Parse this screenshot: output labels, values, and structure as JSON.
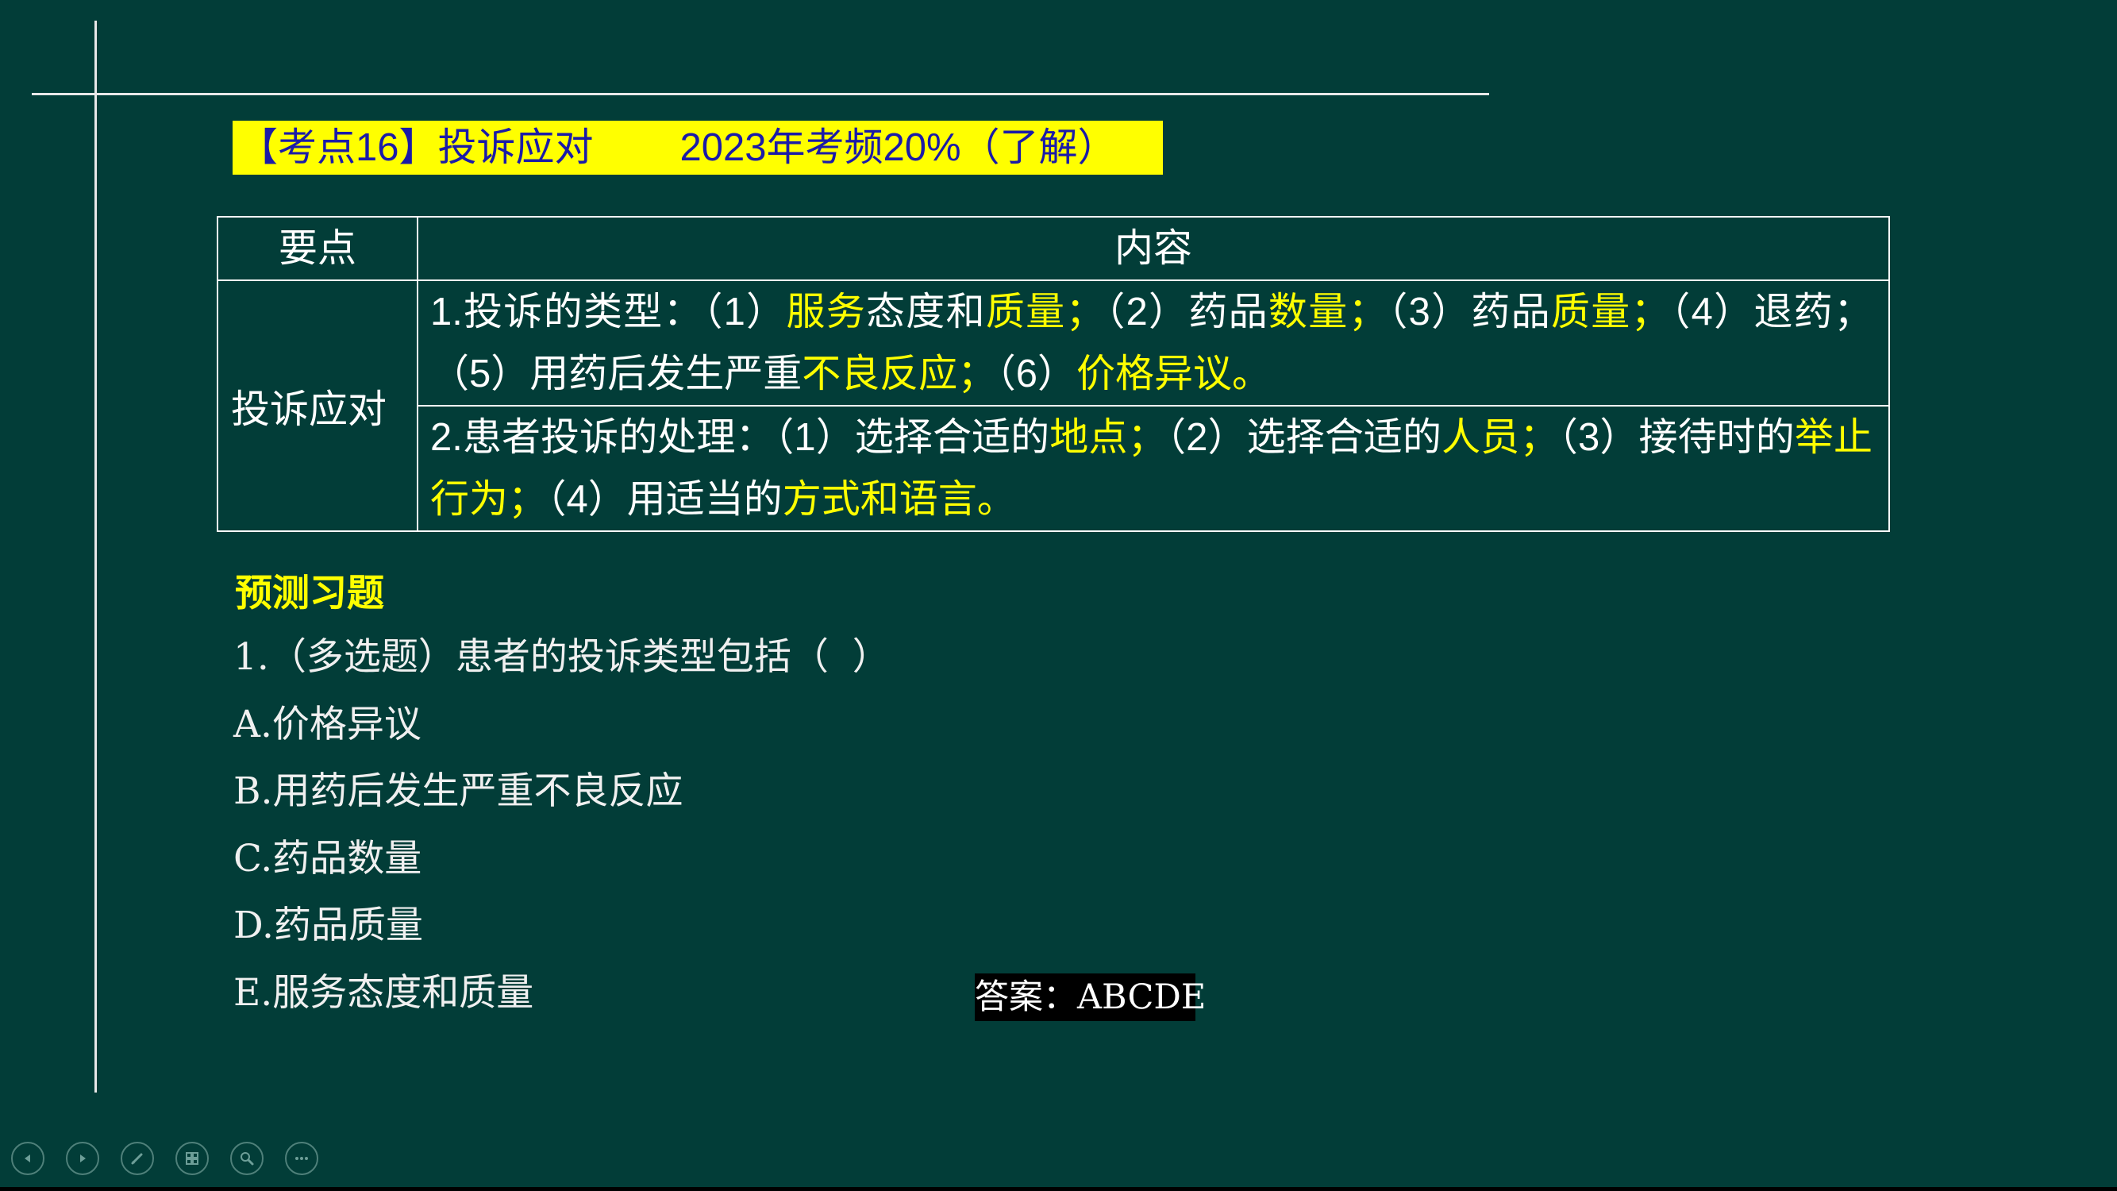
{
  "slide": {
    "title_left": "【考点16】投诉应对",
    "title_right": "2023年考频20%（了解）",
    "table": {
      "header_key": "要点",
      "header_content": "内容",
      "row_key": "投诉应对",
      "item1": [
        "1.投诉的类型：（1）",
        "服务",
        "态度和",
        "质量；",
        "（2）药品",
        "数量；",
        "（3）药品",
        "质量；",
        "（4）退药；（5）用药后发生严重",
        "不良反应；",
        "（6）",
        "价格异议。"
      ],
      "item2": [
        "2.患者投诉的处理：（1）选择合适的",
        "地点；",
        "（2）选择合适的",
        "人员；",
        "（3）接待时的",
        "举止行为；",
        "（4）用适当的",
        "方式和语言。"
      ]
    },
    "practice": {
      "heading": "预测习题",
      "question": "1.（多选题）患者的投诉类型包括（  ）",
      "options": [
        "A.价格异议",
        "B.用药后发生严重不良反应",
        "C.药品数量",
        "D.药品质量",
        "E.服务态度和质量"
      ],
      "answer": "答案：ABCDE"
    }
  },
  "colors": {
    "background": "#023d38",
    "highlight": "#ffff00",
    "title_text": "#1b1ba8",
    "answer_background": "#000000"
  },
  "controls": {
    "icons": [
      "previous-icon",
      "next-icon",
      "pen-icon",
      "slides-icon",
      "zoom-icon",
      "more-icon"
    ]
  }
}
